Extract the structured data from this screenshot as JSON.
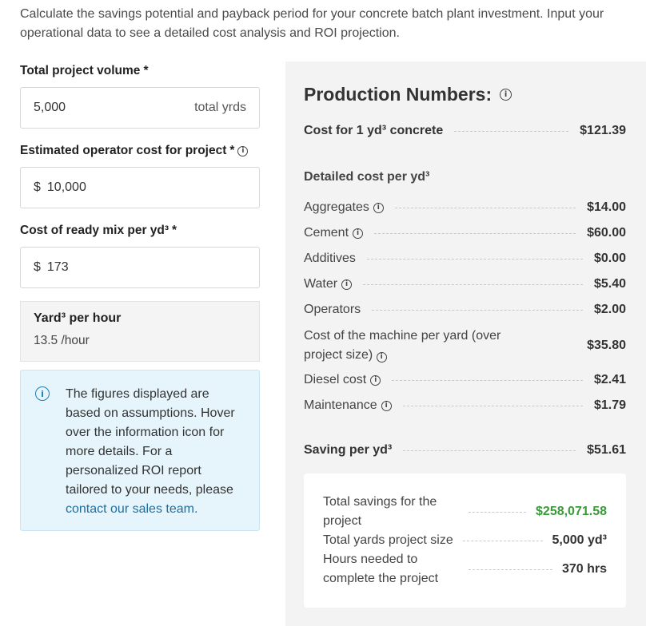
{
  "intro": "Calculate the savings potential and payback period for your concrete batch plant investment. Input your operational data to see a detailed cost analysis and ROI projection.",
  "form": {
    "volume_label": "Total project volume",
    "required_mark": "*",
    "volume_value": "5,000",
    "volume_unit": "total yrds",
    "operator_label": "Estimated operator cost for project",
    "currency": "$",
    "operator_value": "10,000",
    "readymix_label": "Cost of ready mix per yd³",
    "readymix_value": "173",
    "yph_title": "Yard³ per hour",
    "yph_value": "13.5 /hour"
  },
  "note": {
    "text": "The figures displayed are based on assumptions. Hover over the information icon for more details. For a personalized ROI report tailored to your needs, please",
    "link": "contact our sales team."
  },
  "panel": {
    "title": "Production Numbers:",
    "cost_1yd_label": "Cost for 1 yd³ concrete",
    "cost_1yd_value": "$121.39",
    "detailed_label": "Detailed cost per yd³",
    "items": [
      {
        "label": "Aggregates",
        "value": "$14.00"
      },
      {
        "label": "Cement",
        "value": "$60.00"
      },
      {
        "label": "Additives",
        "value": "$0.00"
      },
      {
        "label": "Water",
        "value": "$5.40"
      },
      {
        "label": "Operators",
        "value": "$2.00"
      },
      {
        "label": "Cost of the machine per yard (over project size)",
        "value": "$35.80"
      },
      {
        "label": "Diesel cost",
        "value": "$2.41"
      },
      {
        "label": "Maintenance",
        "value": "$1.79"
      }
    ],
    "saving_label": "Saving per yd³",
    "saving_value": "$51.61"
  },
  "summary": {
    "total_savings_label": "Total savings for the project",
    "total_savings_value": "$258,071.58",
    "total_yards_label": "Total yards project size",
    "total_yards_value": "5,000 yd³",
    "hours_label": "Hours needed to complete the project",
    "hours_value": "370 hrs"
  },
  "colors": {
    "green": "#3a9a3a",
    "link": "#1a6fa3",
    "note_bg": "#e6f4fb"
  },
  "icons": [
    "info-icon"
  ]
}
